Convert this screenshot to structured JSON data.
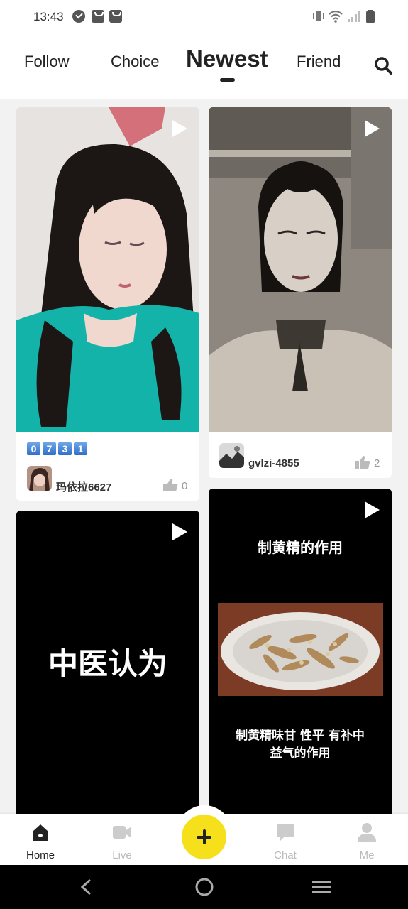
{
  "status_bar": {
    "time": "13:43"
  },
  "top_tabs": [
    {
      "label": "Follow"
    },
    {
      "label": "Choice"
    },
    {
      "label": "Newest",
      "active": true
    },
    {
      "label": "Friend"
    }
  ],
  "feed": {
    "cards": [
      {
        "badge_digits": [
          "0",
          "7",
          "3",
          "1"
        ],
        "username": "玛依拉6627",
        "likes": "0"
      },
      {
        "username": "gvlzi-4855",
        "likes": "2"
      },
      {
        "overlay_text": "中医认为"
      },
      {
        "title": "制黄精的作用",
        "body_line1": "制黄精味甘 性平 有补中",
        "body_line2": "益气的作用"
      }
    ]
  },
  "bottom_nav": {
    "items": [
      {
        "label": "Home",
        "icon": "home-icon",
        "active": true
      },
      {
        "label": "Live",
        "icon": "video-camera-icon"
      },
      {
        "label": "Chat",
        "icon": "chat-bubble-icon"
      },
      {
        "label": "Me",
        "icon": "person-icon"
      }
    ],
    "create": {
      "icon": "plus-icon"
    }
  },
  "colors": {
    "accent": "#f6e01c",
    "text": "#222222",
    "inactive": "#bbbbbb"
  }
}
